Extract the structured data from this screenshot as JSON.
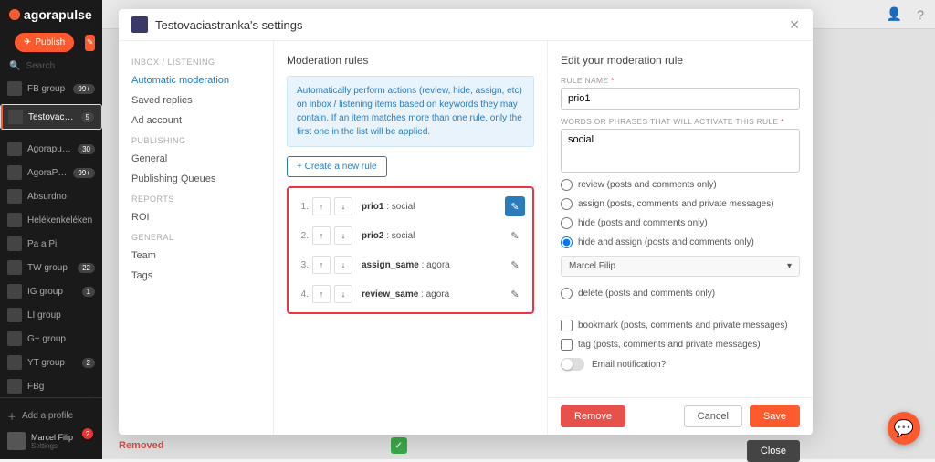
{
  "brand": "agorapulse",
  "publish_label": "Publish",
  "search_placeholder": "Search",
  "profiles": [
    {
      "label": "FB group",
      "badge": "99+"
    },
    {
      "label": "Testovaciastranka",
      "badge": "5",
      "active": true
    },
    {
      "label": "Agorapulse BETA",
      "badge": "30"
    },
    {
      "label": "AgoraPulse",
      "badge": "99+"
    },
    {
      "label": "Absurdno",
      "badge": ""
    },
    {
      "label": "Helékenkeléken",
      "badge": ""
    },
    {
      "label": "Pa a Pi",
      "badge": ""
    },
    {
      "label": "TW group",
      "badge": "22"
    },
    {
      "label": "IG group",
      "badge": "1"
    },
    {
      "label": "LI group",
      "badge": ""
    },
    {
      "label": "G+ group",
      "badge": ""
    },
    {
      "label": "YT group",
      "badge": "2"
    },
    {
      "label": "FBg",
      "badge": ""
    }
  ],
  "add_profile": "Add a profile",
  "user": {
    "name": "Marcel Filip",
    "sub": "Settings",
    "notif": "2"
  },
  "removed_label": "Removed",
  "modal": {
    "title": "Testovaciastranka's settings",
    "nav": {
      "s1": "INBOX / LISTENING",
      "i1": "Automatic moderation",
      "i2": "Saved replies",
      "i3": "Ad account",
      "s2": "PUBLISHING",
      "i4": "General",
      "i5": "Publishing Queues",
      "s3": "REPORTS",
      "i6": "ROI",
      "s4": "GENERAL",
      "i7": "Team",
      "i8": "Tags"
    },
    "center": {
      "heading": "Moderation rules",
      "hint": "Automatically perform actions (review, hide, assign, etc) on inbox / listening items based on keywords they may contain. If an item matches more than one rule, only the first one in the list will be applied.",
      "create": "+ Create a new rule",
      "rules": [
        {
          "n": "1.",
          "name": "prio1",
          "kw": "social",
          "active": true
        },
        {
          "n": "2.",
          "name": "prio2",
          "kw": "social"
        },
        {
          "n": "3.",
          "name": "assign_same",
          "kw": "agora"
        },
        {
          "n": "4.",
          "name": "review_same",
          "kw": "agora"
        }
      ]
    },
    "right": {
      "heading": "Edit your moderation rule",
      "rule_name_label": "RULE NAME",
      "rule_name": "prio1",
      "words_label": "WORDS OR PHRASES THAT WILL ACTIVATE THIS RULE",
      "words": "social",
      "opts": {
        "review": "review (posts and comments only)",
        "assign": "assign (posts, comments and private messages)",
        "hide": "hide (posts and comments only)",
        "hide_assign": "hide and assign (posts and comments only)",
        "assignee": "Marcel Filip",
        "delete": "delete (posts and comments only)",
        "bookmark": "bookmark (posts, comments and private messages)",
        "tag": "tag (posts, comments and private messages)",
        "email": "Email notification?"
      }
    },
    "buttons": {
      "remove": "Remove",
      "cancel": "Cancel",
      "save": "Save",
      "close": "Close"
    }
  }
}
